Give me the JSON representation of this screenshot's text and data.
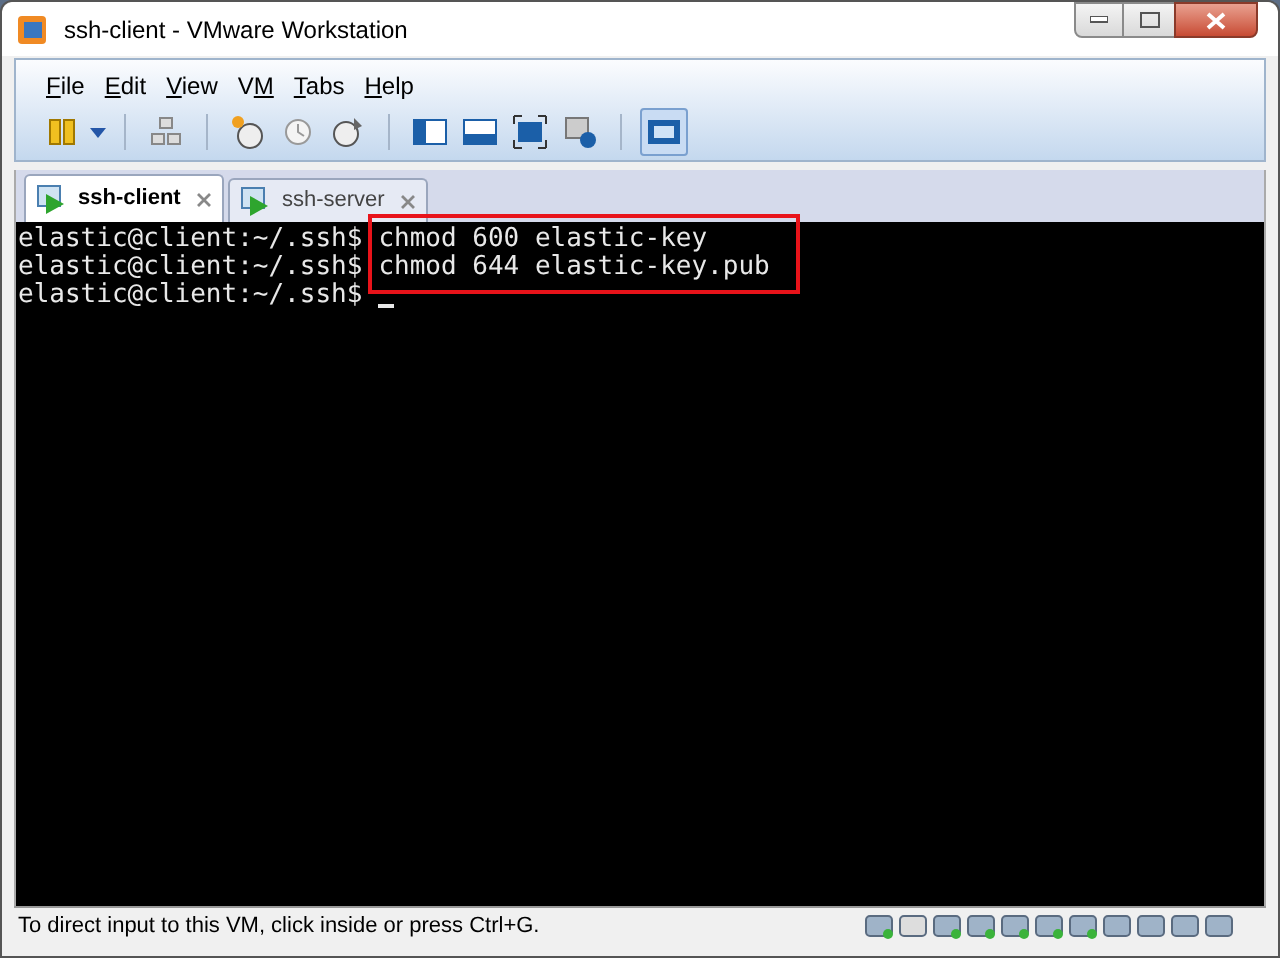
{
  "window": {
    "title": "ssh-client - VMware Workstation"
  },
  "menu": [
    {
      "accel": "F",
      "rest": "ile"
    },
    {
      "accel": "E",
      "rest": "dit"
    },
    {
      "accel": "V",
      "rest": "iew"
    },
    {
      "lead": "V",
      "accel": "M"
    },
    {
      "accel": "T",
      "rest": "abs"
    },
    {
      "accel": "H",
      "rest": "elp"
    }
  ],
  "tabs": [
    {
      "label": "ssh-client",
      "selected": true
    },
    {
      "label": "ssh-server",
      "selected": false
    }
  ],
  "terminal": {
    "lines": [
      {
        "prompt": "elastic@client:~/.ssh$",
        "command": "chmod 600 elastic-key",
        "highlighted": true,
        "cursor": false
      },
      {
        "prompt": "elastic@client:~/.ssh$",
        "command": "chmod 644 elastic-key.pub",
        "highlighted": true,
        "cursor": false
      },
      {
        "prompt": "elastic@client:~/.ssh$",
        "highlighted": false,
        "cursor": true
      }
    ]
  },
  "status_bar": {
    "text": "To direct input to this VM, click inside or press Ctrl+G."
  }
}
